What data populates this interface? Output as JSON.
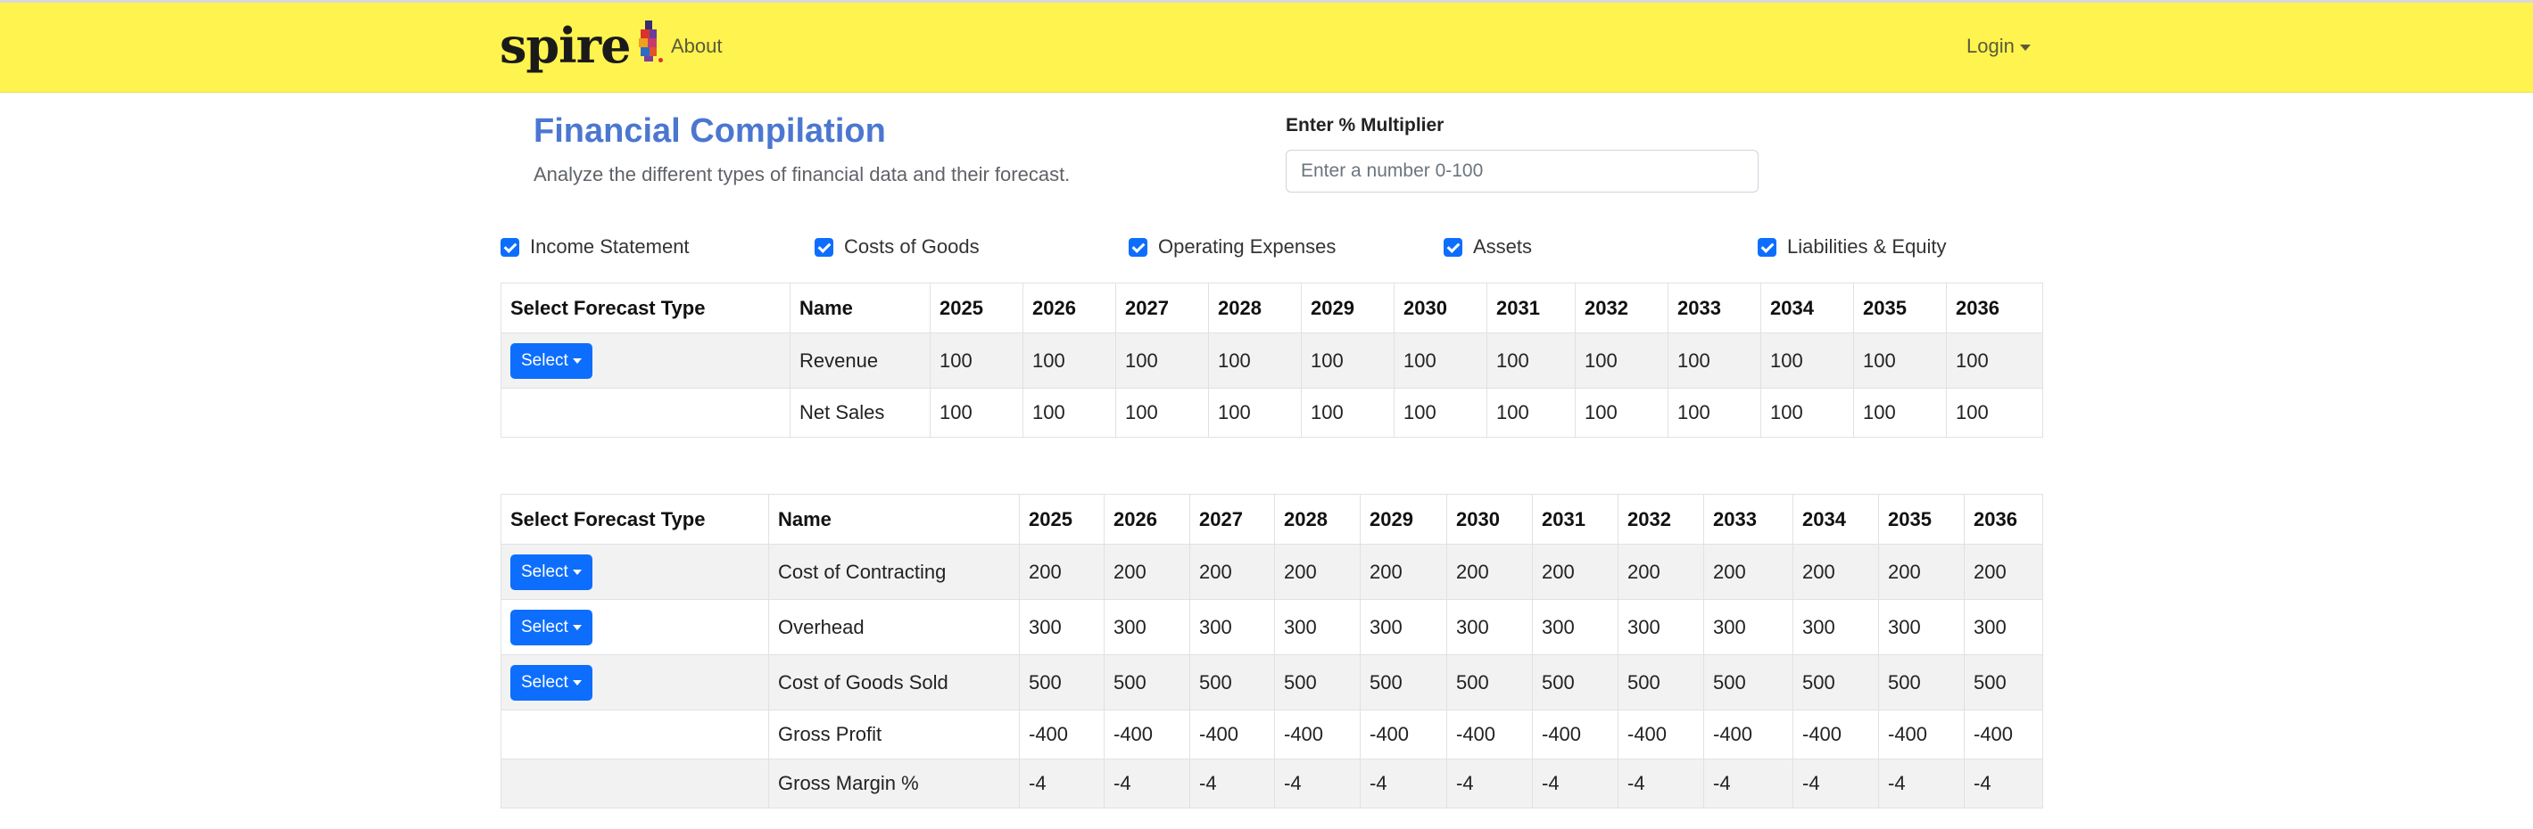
{
  "nav": {
    "brand": "spire",
    "about": "About",
    "login": "Login"
  },
  "colors": {
    "navbar_bg": "#fff34f",
    "title": "#4b77d1",
    "primary_button": "#0d6efd",
    "stripe": "#f2f2f2"
  },
  "header": {
    "title": "Financial Compilation",
    "subtitle": "Analyze the different types of financial data and their forecast."
  },
  "multiplier": {
    "label": "Enter % Multiplier",
    "placeholder": "Enter a number 0-100",
    "value": ""
  },
  "filters": [
    {
      "label": "Income Statement",
      "checked": true
    },
    {
      "label": "Costs of Goods",
      "checked": true
    },
    {
      "label": "Operating Expenses",
      "checked": true
    },
    {
      "label": "Assets",
      "checked": true
    },
    {
      "label": "Liabilities & Equity",
      "checked": true
    }
  ],
  "tables": [
    {
      "headers": [
        "Select Forecast Type",
        "Name",
        "2025",
        "2026",
        "2027",
        "2028",
        "2029",
        "2030",
        "2031",
        "2032",
        "2033",
        "2034",
        "2035",
        "2036"
      ],
      "rows": [
        {
          "select": "Select",
          "name": "Revenue",
          "values": [
            "100",
            "100",
            "100",
            "100",
            "100",
            "100",
            "100",
            "100",
            "100",
            "100",
            "100",
            "100"
          ]
        },
        {
          "select": "",
          "name": "Net Sales",
          "values": [
            "100",
            "100",
            "100",
            "100",
            "100",
            "100",
            "100",
            "100",
            "100",
            "100",
            "100",
            "100"
          ]
        }
      ]
    },
    {
      "headers": [
        "Select Forecast Type",
        "Name",
        "2025",
        "2026",
        "2027",
        "2028",
        "2029",
        "2030",
        "2031",
        "2032",
        "2033",
        "2034",
        "2035",
        "2036"
      ],
      "rows": [
        {
          "select": "Select",
          "name": "Cost of Contracting",
          "values": [
            "200",
            "200",
            "200",
            "200",
            "200",
            "200",
            "200",
            "200",
            "200",
            "200",
            "200",
            "200"
          ]
        },
        {
          "select": "Select",
          "name": "Overhead",
          "values": [
            "300",
            "300",
            "300",
            "300",
            "300",
            "300",
            "300",
            "300",
            "300",
            "300",
            "300",
            "300"
          ]
        },
        {
          "select": "Select",
          "name": "Cost of Goods Sold",
          "values": [
            "500",
            "500",
            "500",
            "500",
            "500",
            "500",
            "500",
            "500",
            "500",
            "500",
            "500",
            "500"
          ]
        },
        {
          "select": "",
          "name": "Gross Profit",
          "values": [
            "-400",
            "-400",
            "-400",
            "-400",
            "-400",
            "-400",
            "-400",
            "-400",
            "-400",
            "-400",
            "-400",
            "-400"
          ]
        },
        {
          "select": "",
          "name": "Gross Margin %",
          "values": [
            "-4",
            "-4",
            "-4",
            "-4",
            "-4",
            "-4",
            "-4",
            "-4",
            "-4",
            "-4",
            "-4",
            "-4"
          ]
        }
      ]
    }
  ]
}
